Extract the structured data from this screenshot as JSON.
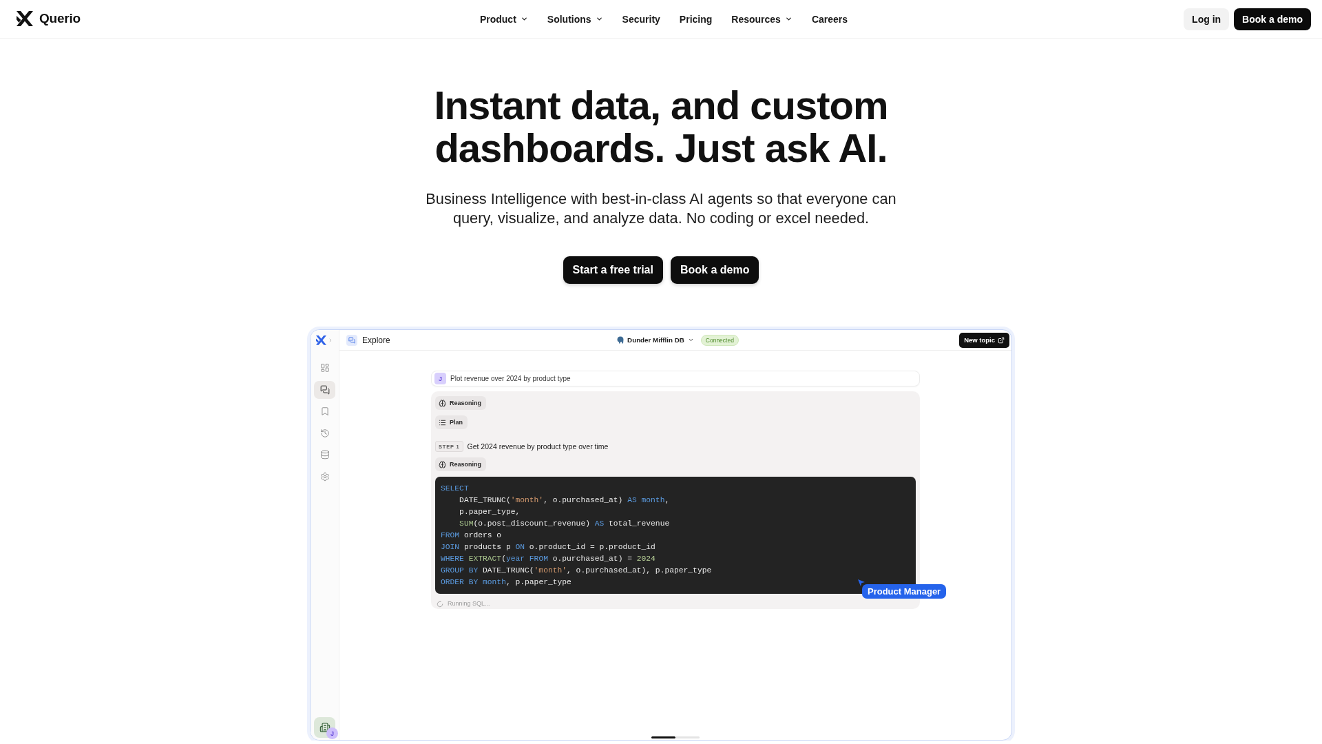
{
  "header": {
    "brand": "Querio",
    "nav": [
      {
        "label": "Product",
        "dropdown": true
      },
      {
        "label": "Solutions",
        "dropdown": true
      },
      {
        "label": "Security",
        "dropdown": false
      },
      {
        "label": "Pricing",
        "dropdown": false
      },
      {
        "label": "Resources",
        "dropdown": true
      },
      {
        "label": "Careers",
        "dropdown": false
      }
    ],
    "actions": [
      {
        "label": "Log in",
        "kind": "secondary"
      },
      {
        "label": "Book a demo",
        "kind": "primary"
      }
    ]
  },
  "hero": {
    "title": "Instant data, and custom dashboards. Just ask AI.",
    "subtitle": "Business Intelligence with best-in-class AI agents so that everyone can query, visualize, and analyze data. No coding or excel needed.",
    "buttons": [
      "Start a free trial",
      "Book a demo"
    ]
  },
  "app_preview": {
    "sidebar": {
      "items": [
        {
          "selected": false
        },
        {
          "selected": true
        },
        {
          "selected": false
        },
        {
          "selected": false
        },
        {
          "selected": false
        },
        {
          "selected": false
        }
      ],
      "user_badge": "J"
    },
    "topbar": {
      "page": "Explore",
      "database": "Dunder Mifflin DB",
      "status": "Connected",
      "new_topic": "New topic"
    },
    "message": {
      "avatar": "J",
      "text": "Plot revenue over 2024 by product type"
    },
    "response": [
      {
        "kind": "reasoning",
        "label": "Reasoning"
      },
      {
        "kind": "plan",
        "label": "Plan"
      },
      {
        "kind": "step",
        "badge": "STEP 1",
        "text": "Get 2024 revenue by product type over time"
      },
      {
        "kind": "reasoning",
        "label": "Reasoning"
      },
      {
        "kind": "code",
        "lines": [
          {
            "indented": false,
            "tokens": [
              {
                "text": "SELECT",
                "kind": "keyword"
              }
            ]
          },
          {
            "indented": true,
            "tokens": [
              {
                "text": "DATE_TRUNC(",
                "kind": "plain"
              },
              {
                "text": "'month'",
                "kind": "string"
              },
              {
                "text": ", o.purchased_at) ",
                "kind": "plain"
              },
              {
                "text": "AS month",
                "kind": "keyword"
              },
              {
                "text": ",",
                "kind": "plain"
              }
            ]
          },
          {
            "indented": true,
            "tokens": [
              {
                "text": "p.paper_type,",
                "kind": "plain"
              }
            ]
          },
          {
            "indented": true,
            "tokens": [
              {
                "text": "SUM",
                "kind": "function"
              },
              {
                "text": "(o.post_discount_revenue) ",
                "kind": "plain"
              },
              {
                "text": "AS",
                "kind": "keyword"
              },
              {
                "text": " total_revenue",
                "kind": "plain"
              }
            ]
          },
          {
            "indented": false,
            "tokens": [
              {
                "text": "FROM",
                "kind": "keyword"
              },
              {
                "text": " orders o",
                "kind": "plain"
              }
            ]
          },
          {
            "indented": false,
            "tokens": [
              {
                "text": "JOIN",
                "kind": "keyword"
              },
              {
                "text": " products p ",
                "kind": "plain"
              },
              {
                "text": "ON",
                "kind": "keyword"
              },
              {
                "text": " o.product_id = p.product_id",
                "kind": "plain"
              }
            ]
          },
          {
            "indented": false,
            "tokens": [
              {
                "text": "WHERE ",
                "kind": "keyword"
              },
              {
                "text": "EXTRACT",
                "kind": "function"
              },
              {
                "text": "(",
                "kind": "plain"
              },
              {
                "text": "year FROM",
                "kind": "keyword"
              },
              {
                "text": " o.purchased_at) = ",
                "kind": "plain"
              },
              {
                "text": "2024",
                "kind": "number"
              }
            ]
          },
          {
            "indented": false,
            "tokens": [
              {
                "text": "GROUP BY",
                "kind": "keyword"
              },
              {
                "text": " DATE_TRUNC(",
                "kind": "plain"
              },
              {
                "text": "'month'",
                "kind": "string"
              },
              {
                "text": ", o.purchased_at), p.paper_type",
                "kind": "plain"
              }
            ]
          },
          {
            "indented": false,
            "tokens": [
              {
                "text": "ORDER BY month",
                "kind": "keyword"
              },
              {
                "text": ", p.paper_type",
                "kind": "plain"
              }
            ]
          }
        ]
      },
      {
        "kind": "status",
        "text": "Running SQL..."
      }
    ],
    "cursor_label": "Product Manager",
    "pager": [
      {
        "selected": true
      },
      {
        "selected": false
      }
    ]
  }
}
